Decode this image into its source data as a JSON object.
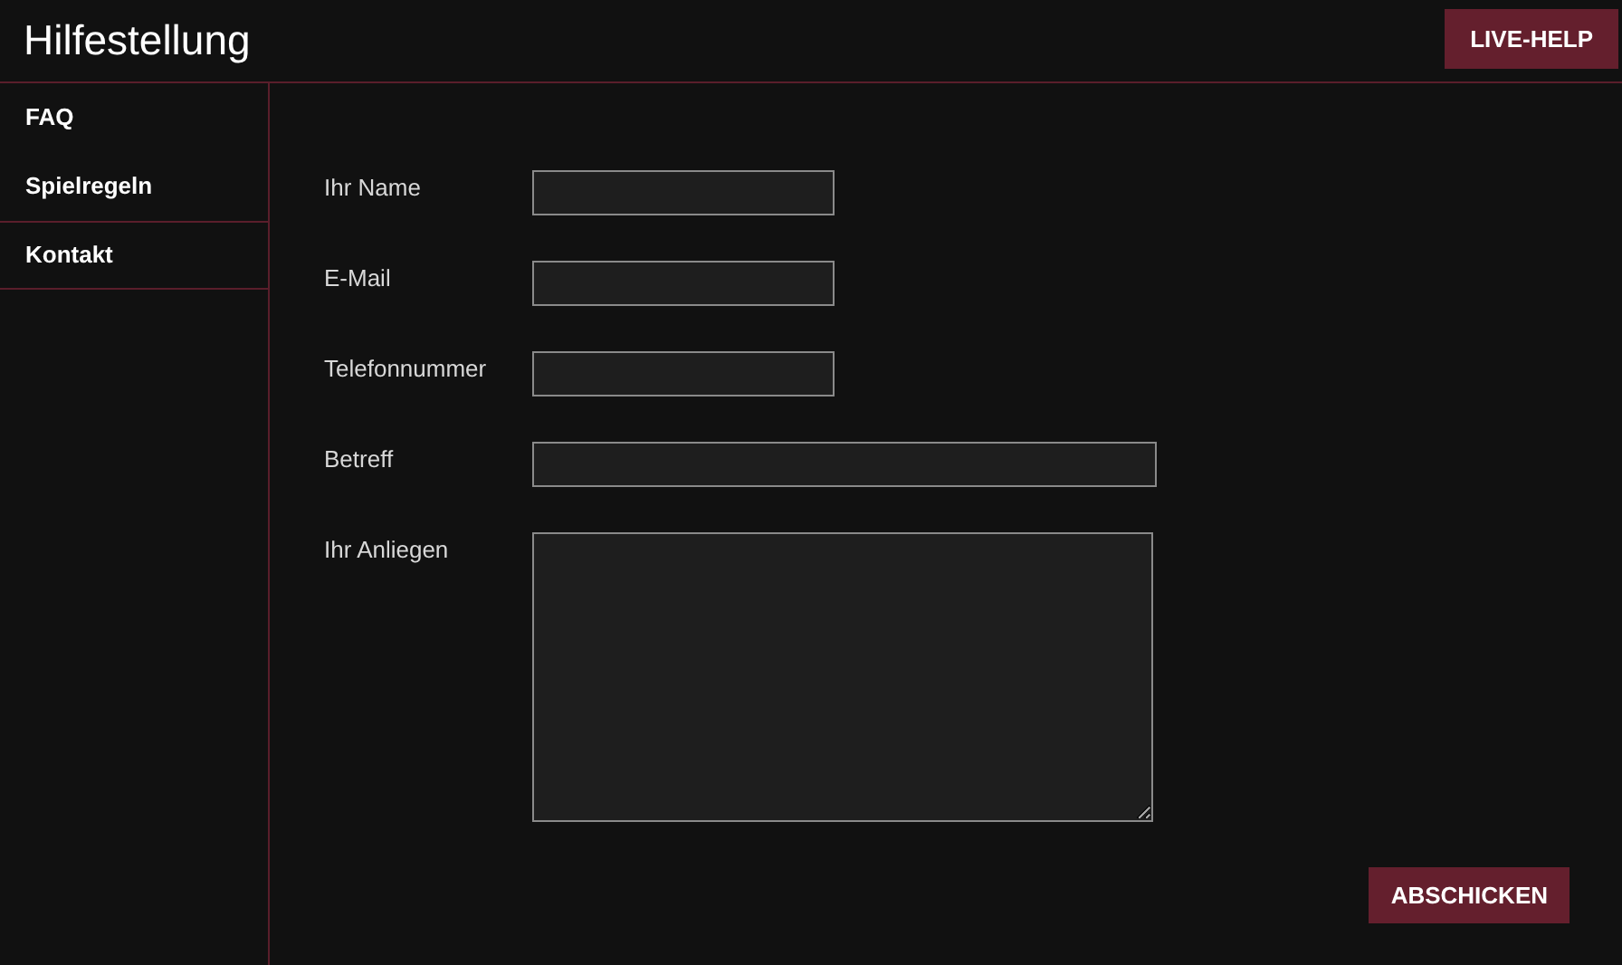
{
  "header": {
    "title": "Hilfestellung",
    "live_help_button": "LIVE-HELP"
  },
  "sidebar": {
    "items": [
      {
        "label": "FAQ",
        "selected": false
      },
      {
        "label": "Spielregeln",
        "selected": false
      },
      {
        "label": "Kontakt",
        "selected": true
      }
    ]
  },
  "form": {
    "fields": [
      {
        "label": "Ihr Name",
        "kind": "short"
      },
      {
        "label": "E-Mail",
        "kind": "short"
      },
      {
        "label": "Telefonnummer",
        "kind": "short"
      },
      {
        "label": "Betreff",
        "kind": "long"
      },
      {
        "label": "Ihr Anliegen",
        "kind": "textarea"
      }
    ],
    "submit_button": "ABSCHICKEN"
  }
}
